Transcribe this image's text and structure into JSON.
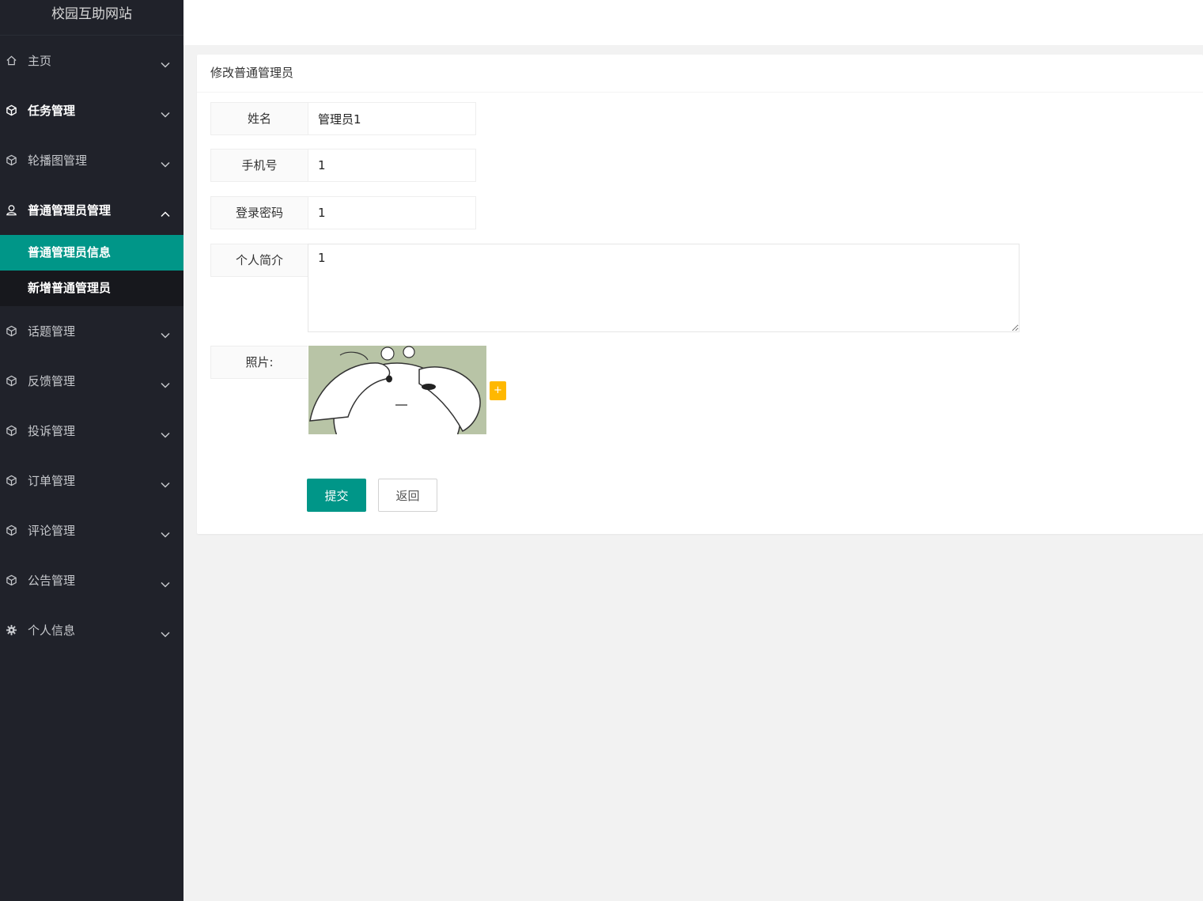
{
  "sidebar": {
    "brand": "校园互助网站",
    "items": [
      {
        "label": "主页",
        "icon": "home-icon"
      },
      {
        "label": "任务管理",
        "icon": "cube-icon"
      },
      {
        "label": "轮播图管理",
        "icon": "cube-icon"
      },
      {
        "label": "普通管理员管理",
        "icon": "user-icon"
      },
      {
        "label": "话题管理",
        "icon": "cube-icon"
      },
      {
        "label": "反馈管理",
        "icon": "cube-icon"
      },
      {
        "label": "投诉管理",
        "icon": "cube-icon"
      },
      {
        "label": "订单管理",
        "icon": "cube-icon"
      },
      {
        "label": "评论管理",
        "icon": "cube-icon"
      },
      {
        "label": "公告管理",
        "icon": "cube-icon"
      },
      {
        "label": "个人信息",
        "icon": "gear-icon"
      }
    ],
    "submenu": [
      {
        "label": "普通管理员信息",
        "active": true
      },
      {
        "label": "新增普通管理员",
        "active": false
      }
    ]
  },
  "card": {
    "title": "修改普通管理员"
  },
  "form": {
    "name_label": "姓名",
    "name_value": "管理员1",
    "phone_label": "手机号",
    "phone_value": "1",
    "password_label": "登录密码",
    "password_value": "1",
    "intro_label": "个人简介",
    "intro_value": "1",
    "photo_label": "照片:",
    "add_label": "+",
    "submit_label": "提交",
    "back_label": "返回"
  },
  "colors": {
    "accent": "#009688",
    "sidebar_bg": "#20222a",
    "warning": "#ffb800"
  }
}
